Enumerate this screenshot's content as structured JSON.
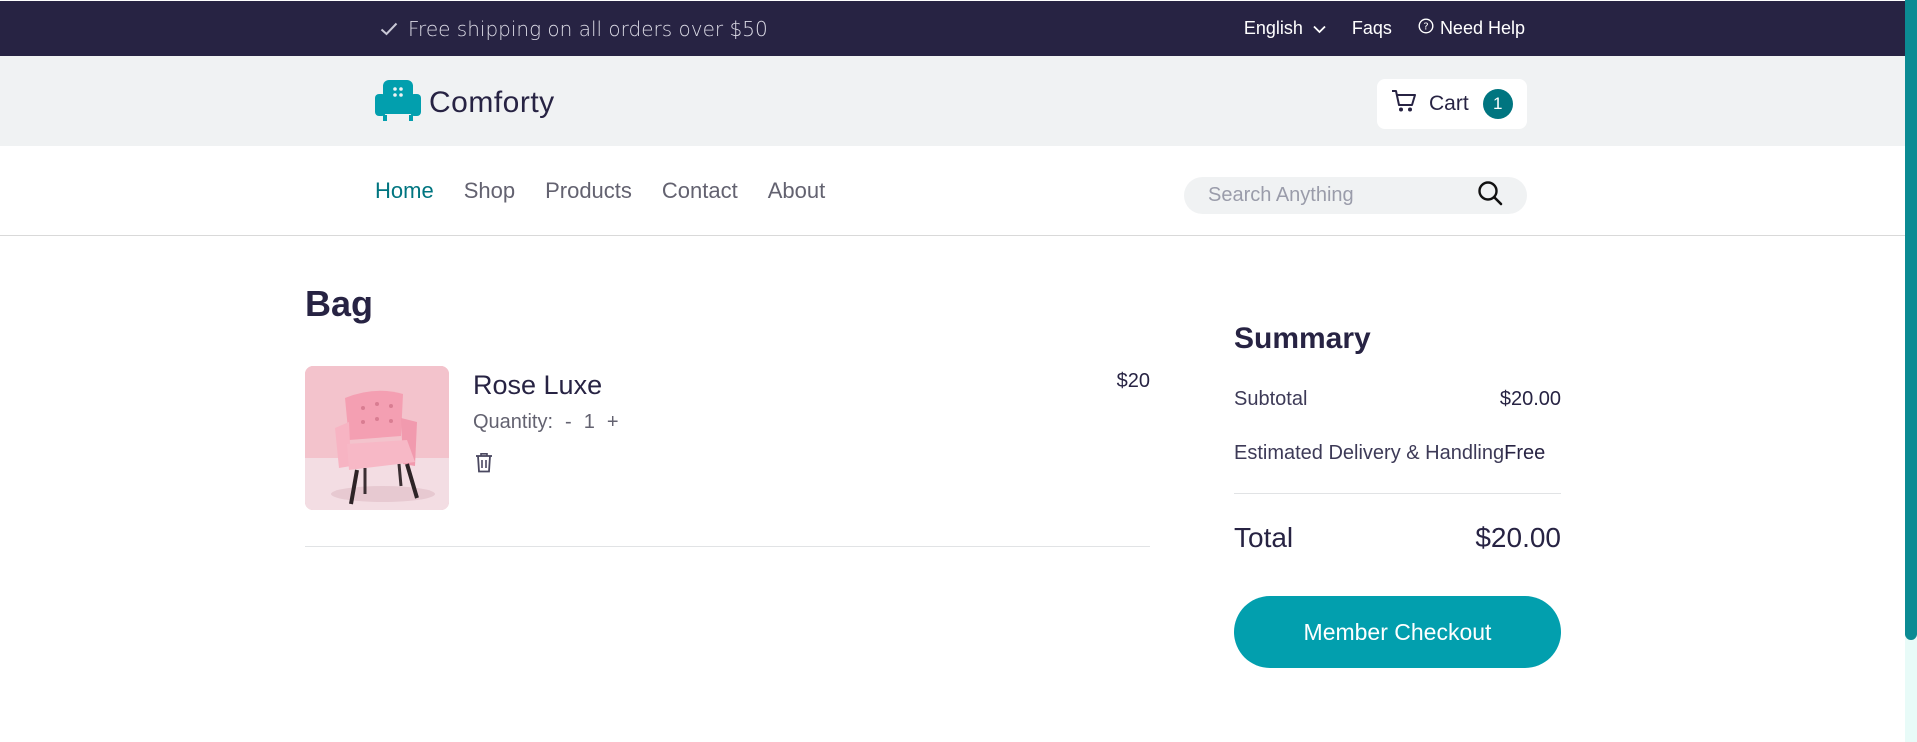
{
  "topbar": {
    "shipping_text": "Free shipping on all orders over $50",
    "language": "English",
    "faqs": "Faqs",
    "need_help": "Need Help"
  },
  "header": {
    "brand": "Comforty",
    "cart_label": "Cart",
    "cart_count": "1"
  },
  "nav": {
    "items": [
      {
        "label": "Home",
        "active": true
      },
      {
        "label": "Shop"
      },
      {
        "label": "Products"
      },
      {
        "label": "Contact"
      },
      {
        "label": "About"
      }
    ],
    "search_placeholder": "Search Anything"
  },
  "bag": {
    "title": "Bag",
    "items": [
      {
        "name": "Rose Luxe",
        "quantity_label": "Quantity:",
        "minus": "-",
        "quantity": "1",
        "plus": "+",
        "price": "$20"
      }
    ]
  },
  "summary": {
    "title": "Summary",
    "subtotal_label": "Subtotal",
    "subtotal_value": "$20.00",
    "delivery_label": "Estimated Delivery & Handling",
    "delivery_value": "Free",
    "total_label": "Total",
    "total_value": "$20.00",
    "checkout_label": "Member Checkout"
  },
  "colors": {
    "topbar_bg": "#272343",
    "header_bg": "#f0f2f3",
    "accent": "#007580",
    "checkout_bg": "#029fae",
    "logo": "#029fae"
  }
}
